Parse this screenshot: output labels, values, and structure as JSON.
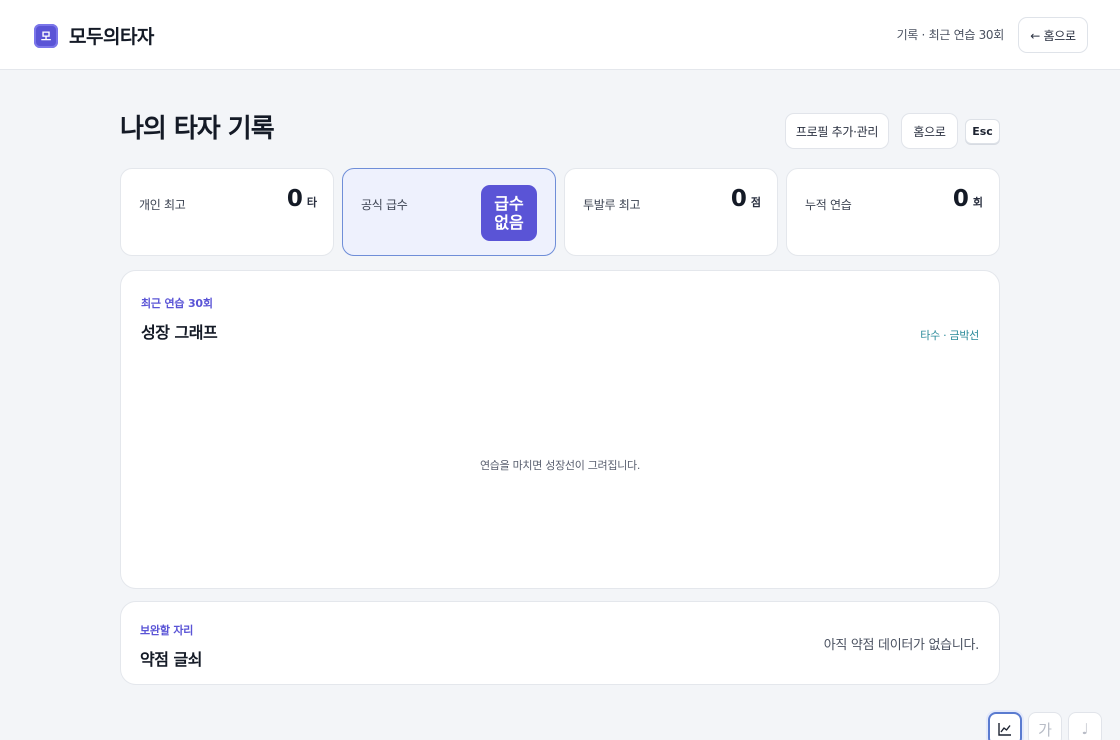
{
  "brand": {
    "logo_glyph": "모",
    "name": "모두의타자"
  },
  "topbar": {
    "status": "기록 · 최근 연습 30회",
    "home_button": "← 홈으로"
  },
  "page": {
    "title": "나의 타자 기록"
  },
  "actions": {
    "profile_button": "프로필 추가·관리",
    "home_button": "홈으로",
    "esc_key": "Esc"
  },
  "stats": [
    {
      "label": "개인 최고",
      "value": "0",
      "unit": "타"
    },
    {
      "label": "공식 급수",
      "badge": "급수\n없음"
    },
    {
      "label": "투발루 최고",
      "value": "0",
      "unit": "점"
    },
    {
      "label": "누적 연습",
      "value": "0",
      "unit": "회"
    }
  ],
  "growth": {
    "eyebrow": "최근 연습 30회",
    "title": "성장 그래프",
    "legend": "타수 · 금박선",
    "empty_message": "연습을 마치면 성장선이 그려집니다."
  },
  "weak": {
    "eyebrow": "보완할 자리",
    "title": "약점 글쇠",
    "empty_message": "아직 약점 데이터가 없습니다."
  },
  "toolbar": {
    "chart_icon": "chart-icon",
    "hangul_glyph": "가",
    "music_glyph": "♩"
  },
  "colors": {
    "accent": "#5a54d6",
    "legend_teal": "#2a8a9a",
    "highlight_bg": "#eef1fd"
  }
}
